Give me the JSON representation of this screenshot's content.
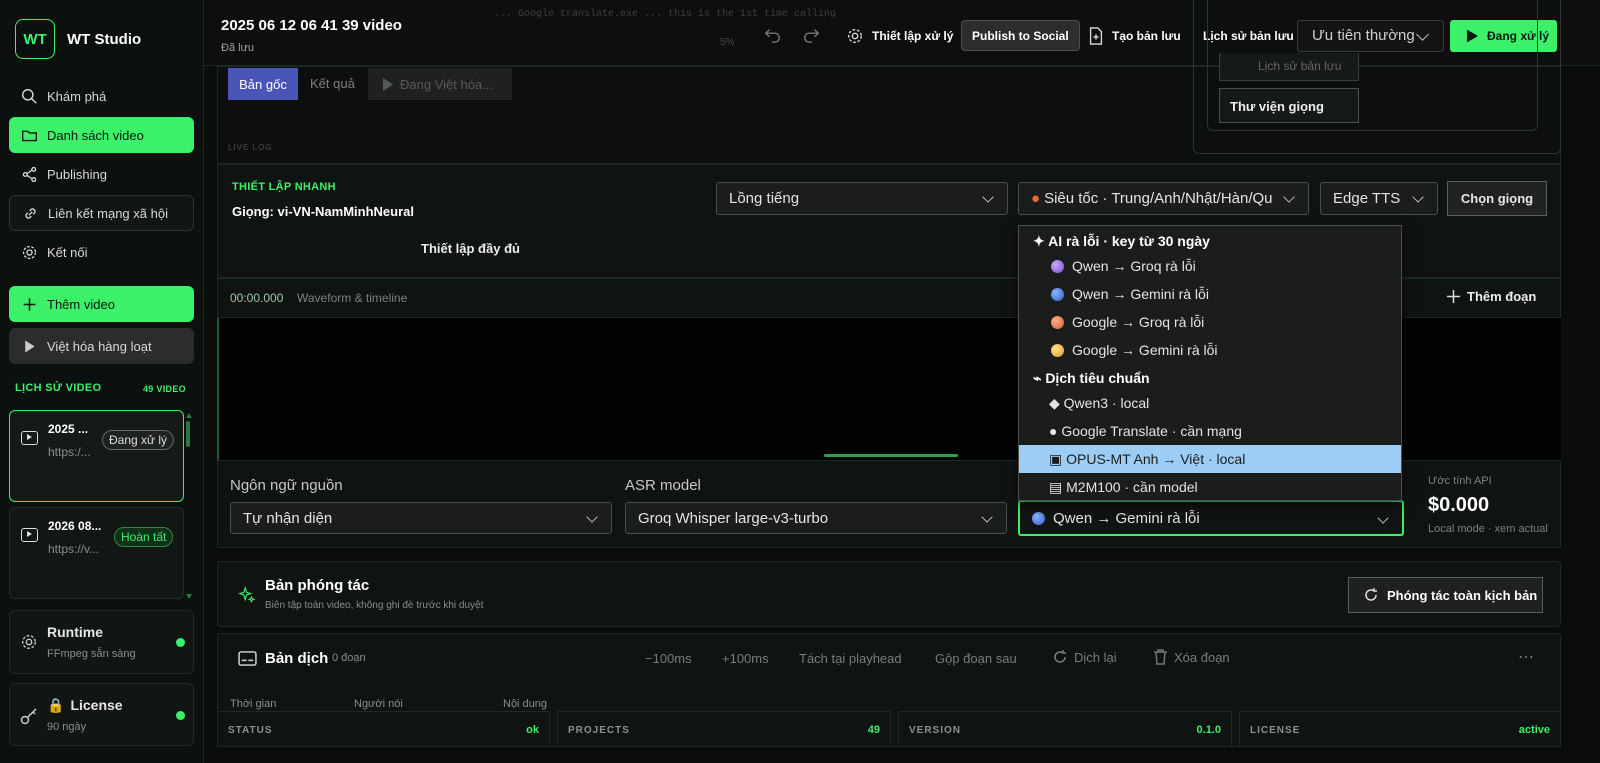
{
  "app": {
    "name": "WT Studio",
    "logo": "WT"
  },
  "nav": [
    {
      "label": "Khám phá",
      "icon": "search-icon"
    },
    {
      "label": "Danh sách video",
      "icon": "folder-icon"
    },
    {
      "label": "Publishing",
      "icon": "share-icon"
    },
    {
      "label": "Liên kết mạng xã hội",
      "icon": "link-icon"
    },
    {
      "label": "Kết nối",
      "icon": "gear-icon"
    }
  ],
  "add_video": "Thêm video",
  "batch": "Việt hóa hàng loạt",
  "history": {
    "title": "LỊCH SỬ VIDEO",
    "count": "49 VIDEO",
    "items": [
      {
        "title": "2025 ...",
        "url": "https:/...",
        "status": "Đang xử lý"
      },
      {
        "title": "2026 08...",
        "url": "https://v...",
        "status": "Hoàn tất"
      }
    ]
  },
  "runtime": {
    "title": "Runtime",
    "sub": "FFmpeg sẵn sàng"
  },
  "license": {
    "title": "License",
    "sub": "90 ngày"
  },
  "top": {
    "title": "2025 06 12 06 41 39 video",
    "saved": "Đã lưu",
    "settings": "Thiết lập xử lý",
    "publish": "Publish to Social",
    "backup": "Tạo bản lưu",
    "history": "Lịch sử bản lưu",
    "priority": "Ưu tiên thường",
    "process": "Đang xử lý"
  },
  "tabs": {
    "original": "Bản gốc",
    "result": "Kết quả",
    "translating": "Đang Việt hóa..."
  },
  "right_panel": {
    "history_btn": "Lịch sử bản lưu",
    "voice_lib": "Thư viện giọng"
  },
  "quick": {
    "title": "THIẾT LẬP NHANH",
    "voice": "Giọng: vi-VN-NamMinhNeural",
    "full": "Thiết lập đầy đủ",
    "mode": "Lồng tiếng",
    "speed": "Siêu tốc · Trung/Anh/Nhật/Hàn/Qu",
    "tts": "Edge TTS",
    "choose_voice": "Chọn giọng"
  },
  "timeline": {
    "time": "00:00.000",
    "label": "Waveform & timeline",
    "add_segment": "Thêm đoạn"
  },
  "dropdown": {
    "group1": "✦ AI rà lỗi · key từ 30 ngày",
    "ai_items": [
      {
        "label": "Qwen → Groq rà lỗi",
        "color": "#8a5cd6"
      },
      {
        "label": "Qwen → Gemini rà lỗi",
        "color": "#3b78e0"
      },
      {
        "label": "Google → Groq rà lỗi",
        "color": "#e8693a"
      },
      {
        "label": "Google → Gemini rà lỗi",
        "color": "#e8b43a"
      }
    ],
    "group2": "⌁ Dịch tiêu chuẩn",
    "std_items": [
      {
        "label": "◆ Qwen3 · local"
      },
      {
        "label": "● Google Translate · cần mạng"
      },
      {
        "label": "▣ OPUS-MT Anh → Việt · local"
      },
      {
        "label": "▤ M2M100 · cần model"
      }
    ]
  },
  "fields": {
    "src_lang_label": "Ngôn ngữ nguồn",
    "src_lang": "Tự nhận diện",
    "asr_label": "ASR model",
    "asr": "Groq Whisper large-v3-turbo",
    "translator": "Qwen → Gemini rà lỗi",
    "api_label": "Ước tính API",
    "api_cost": "$0.000",
    "api_note": "Local mode · xem actual"
  },
  "adapt": {
    "title": "Bản phóng tác",
    "sub": "Biên tập toàn video, không ghi đè trước khi duyệt",
    "btn": "Phóng tác toàn kịch bản"
  },
  "trans": {
    "title": "Bản dịch",
    "count": "0 đoạn",
    "tools": [
      "−100ms",
      "+100ms",
      "Tách tại playhead",
      "Gộp đoạn sau",
      "Dịch lại",
      "Xóa đoạn"
    ],
    "more": "⋯"
  },
  "cols": [
    "Thời gian",
    "Người nói",
    "Nội dung"
  ],
  "status_bar": [
    {
      "k": "STATUS",
      "v": "ok"
    },
    {
      "k": "PROJECTS",
      "v": "49"
    },
    {
      "k": "VERSION",
      "v": "0.1.0"
    },
    {
      "k": "LICENSE",
      "v": "active"
    }
  ],
  "ghost": {
    "log": "... Google translate.exe ... this is the 1st time calling",
    "pct": "5%",
    "live": "LIVE LOG",
    "ghost_title": "Thiết l..."
  },
  "colors": {
    "accent": "#3cf06a",
    "highlight": "#9ccdf5"
  }
}
